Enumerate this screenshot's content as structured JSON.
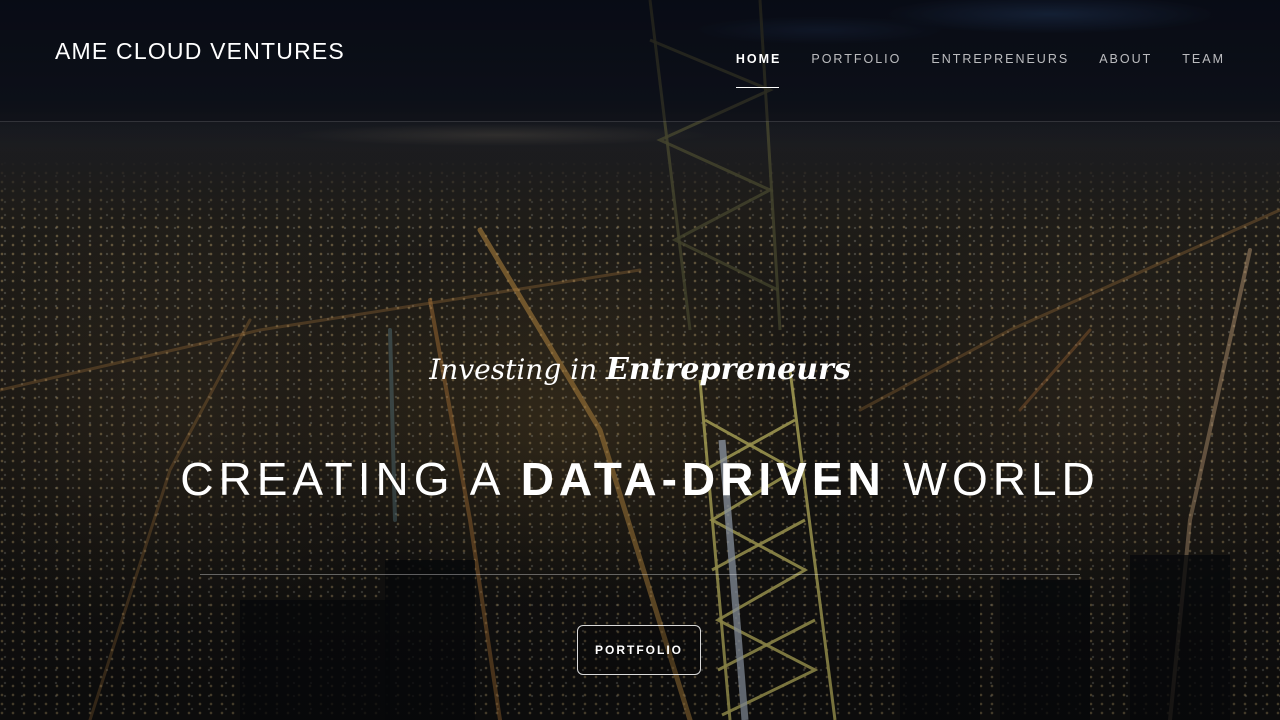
{
  "header": {
    "logo": "AME CLOUD VENTURES",
    "nav": [
      {
        "label": "HOME",
        "active": true
      },
      {
        "label": "PORTFOLIO",
        "active": false
      },
      {
        "label": "ENTREPRENEURS",
        "active": false
      },
      {
        "label": "ABOUT",
        "active": false
      },
      {
        "label": "TEAM",
        "active": false
      }
    ]
  },
  "hero": {
    "tagline_lead": "Investing in ",
    "tagline_emphasis": "Entrepreneurs",
    "headline_before": "CREATING A ",
    "headline_bold": "DATA-DRIVEN",
    "headline_after": " WORLD",
    "cta_label": "PORTFOLIO"
  },
  "colors": {
    "text": "#ffffff",
    "nav_inactive": "#b8b8b8",
    "background_dark": "#0a0d14"
  }
}
